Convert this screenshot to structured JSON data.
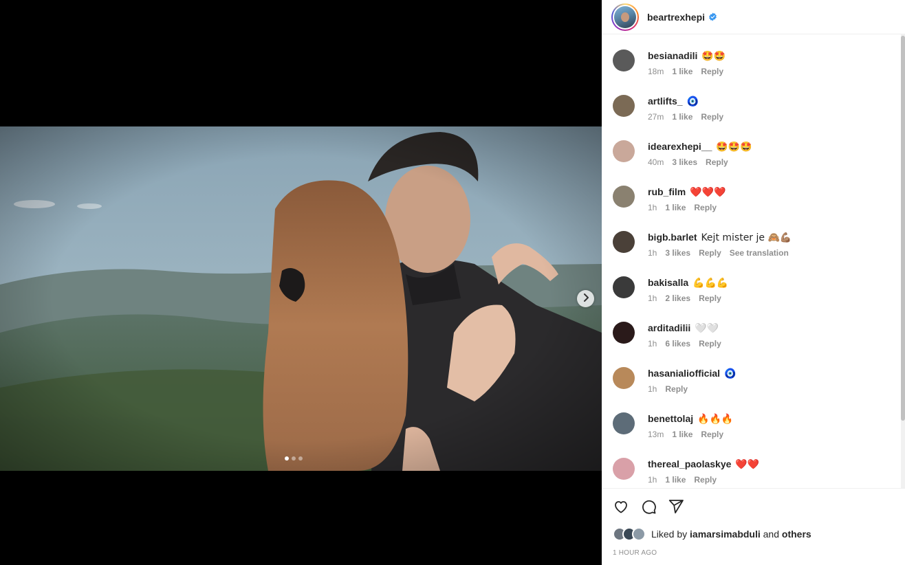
{
  "post": {
    "username": "beartrexhepi",
    "verified": true,
    "carousel": {
      "count": 3,
      "active_index": 0
    }
  },
  "comments": [
    {
      "user": "besianadili",
      "text": "🤩🤩",
      "time": "18m",
      "likes": "1 like",
      "reply": "Reply",
      "avatar_color": "#5a5a5a"
    },
    {
      "user": "artlifts_",
      "text": "🧿",
      "time": "27m",
      "likes": "1 like",
      "reply": "Reply",
      "avatar_color": "#7b6a55"
    },
    {
      "user": "idearexhepi__",
      "text": "🤩🤩🤩",
      "time": "40m",
      "likes": "3 likes",
      "reply": "Reply",
      "avatar_color": "#c9a89a"
    },
    {
      "user": "rub_film",
      "text": "❤️❤️❤️",
      "time": "1h",
      "likes": "1 like",
      "reply": "Reply",
      "avatar_color": "#8a8170"
    },
    {
      "user": "bigb.barlet",
      "text": "Kejt mister je 🙈💪🏽",
      "time": "1h",
      "likes": "3 likes",
      "reply": "Reply",
      "extra": "See translation",
      "avatar_color": "#4a4038"
    },
    {
      "user": "bakisalla",
      "text": "💪💪💪",
      "time": "1h",
      "likes": "2 likes",
      "reply": "Reply",
      "avatar_color": "#3a3a3a"
    },
    {
      "user": "arditadilii",
      "text": "🤍🤍",
      "time": "1h",
      "likes": "6 likes",
      "reply": "Reply",
      "avatar_color": "#2a1a1a"
    },
    {
      "user": "hasanialiofficial",
      "text": "🧿",
      "time": "1h",
      "likes": "",
      "reply": "Reply",
      "avatar_color": "#b8895a"
    },
    {
      "user": "benettolaj",
      "text": "🔥🔥🔥",
      "time": "13m",
      "likes": "1 like",
      "reply": "Reply",
      "avatar_color": "#5d6c78"
    },
    {
      "user": "thereal_paolaskye",
      "text": "❤️❤️",
      "time": "1h",
      "likes": "1 like",
      "reply": "Reply",
      "avatar_color": "#d9a0a8"
    }
  ],
  "actions": {
    "like_icon": "heart-outline-icon",
    "comment_icon": "speech-bubble-icon",
    "share_icon": "paper-plane-icon"
  },
  "liked_by": {
    "prefix": "Liked by",
    "user": "iamarsimabduli",
    "and": "and",
    "others": "others"
  },
  "timestamp": "1 HOUR AGO",
  "colors": {
    "verified": "#3897f0",
    "text": "#262626",
    "secondary": "#8e8e8e"
  }
}
